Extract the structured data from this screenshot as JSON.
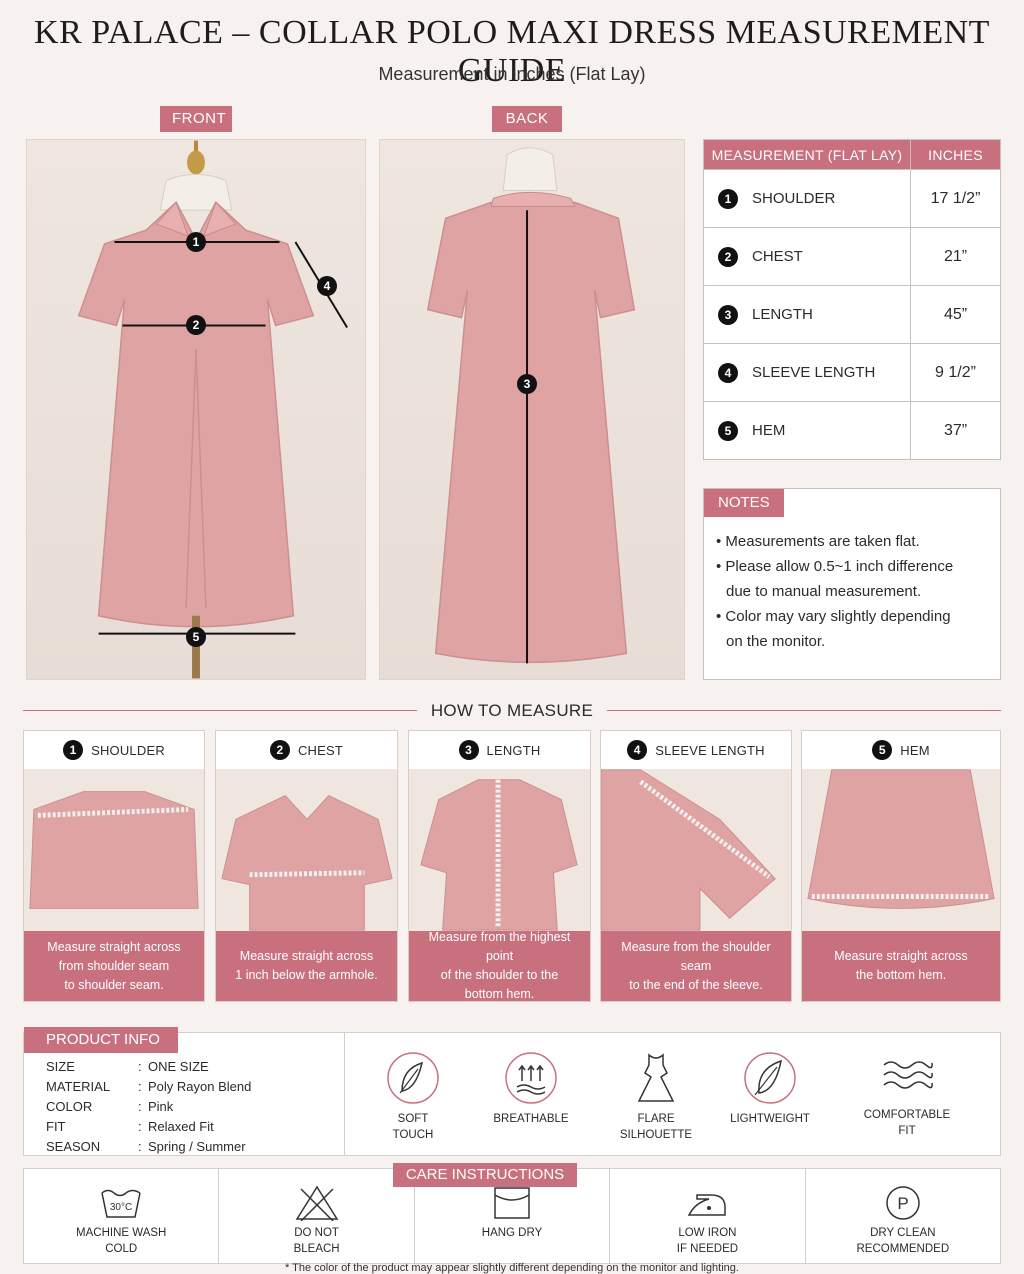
{
  "header": {
    "title": "KR PALACE – COLLAR POLO MAXI DRESS MEASUREMENT GUIDE",
    "subtitle": "Measurement in inches (Flat Lay)"
  },
  "views": {
    "front_label": "FRONT",
    "back_label": "BACK"
  },
  "markers": [
    "1",
    "2",
    "3",
    "4",
    "5"
  ],
  "measurement_table": {
    "col_measurement": "MEASUREMENT (FLAT LAY)",
    "col_inches": "INCHES",
    "rows": [
      {
        "num": "1",
        "name": "SHOULDER",
        "value": "17 1/2”"
      },
      {
        "num": "2",
        "name": "CHEST",
        "value": "21”"
      },
      {
        "num": "3",
        "name": "LENGTH",
        "value": "45”"
      },
      {
        "num": "4",
        "name": "SLEEVE LENGTH",
        "value": "9 1/2”"
      },
      {
        "num": "5",
        "name": "HEM",
        "value": "37”"
      }
    ]
  },
  "notes": {
    "title": "NOTES",
    "items": [
      {
        "line1": "Measurements are taken flat.",
        "line2": ""
      },
      {
        "line1": "Please allow 0.5~1 inch difference",
        "line2": "due to manual measurement."
      },
      {
        "line1": "Color may vary slightly depending",
        "line2": "on the monitor."
      }
    ]
  },
  "how_to_measure": {
    "title": "HOW TO MEASURE",
    "cards": [
      {
        "num": "1",
        "title": "SHOULDER",
        "caption1": "Measure straight across",
        "caption2": "from shoulder seam",
        "caption3": "to shoulder seam."
      },
      {
        "num": "2",
        "title": "CHEST",
        "caption1": "Measure straight across",
        "caption2": "1 inch below the armhole.",
        "caption3": ""
      },
      {
        "num": "3",
        "title": "LENGTH",
        "caption1": "Measure from the highest point",
        "caption2": "of the shoulder to the",
        "caption3": "bottom hem."
      },
      {
        "num": "4",
        "title": "SLEEVE LENGTH",
        "caption1": "Measure from the shoulder seam",
        "caption2": "to the end of the sleeve.",
        "caption3": ""
      },
      {
        "num": "5",
        "title": "HEM",
        "caption1": "Measure straight across",
        "caption2": "the bottom hem.",
        "caption3": ""
      }
    ]
  },
  "product_info": {
    "title": "PRODUCT INFO",
    "rows": [
      {
        "key": "SIZE",
        "value": "ONE SIZE"
      },
      {
        "key": "MATERIAL",
        "value": "Poly Rayon Blend"
      },
      {
        "key": "COLOR",
        "value": "Pink"
      },
      {
        "key": "FIT",
        "value": "Relaxed Fit"
      },
      {
        "key": "SEASON",
        "value": "Spring / Summer"
      }
    ],
    "features": [
      {
        "icon": "feather-icon",
        "line1": "SOFT",
        "line2": "TOUCH"
      },
      {
        "icon": "breathable-icon",
        "line1": "BREATHABLE",
        "line2": ""
      },
      {
        "icon": "dress-icon",
        "line1": "FLARE",
        "line2": "SILHOUETTE"
      },
      {
        "icon": "feather-icon",
        "line1": "LIGHTWEIGHT",
        "line2": ""
      },
      {
        "icon": "waves-icon",
        "line1": "COMFORTABLE",
        "line2": "FIT"
      }
    ]
  },
  "care": {
    "title": "CARE INSTRUCTIONS",
    "temp": "30°C",
    "dry_clean_letter": "P",
    "items": [
      {
        "icon": "machine-wash-icon",
        "line1": "MACHINE WASH",
        "line2": "COLD"
      },
      {
        "icon": "no-bleach-icon",
        "line1": "DO NOT",
        "line2": "BLEACH"
      },
      {
        "icon": "hang-dry-icon",
        "line1": "HANG DRY",
        "line2": ""
      },
      {
        "icon": "low-iron-icon",
        "line1": "LOW IRON",
        "line2": "IF NEEDED"
      },
      {
        "icon": "dry-clean-icon",
        "line1": "DRY CLEAN",
        "line2": "RECOMMENDED"
      }
    ]
  },
  "footnote": "* The color of the product may appear slightly different depending on the monitor and lighting.",
  "colors": {
    "accent": "#c9707e",
    "dress": "#e0a3a3",
    "background": "#f7f2ef"
  }
}
